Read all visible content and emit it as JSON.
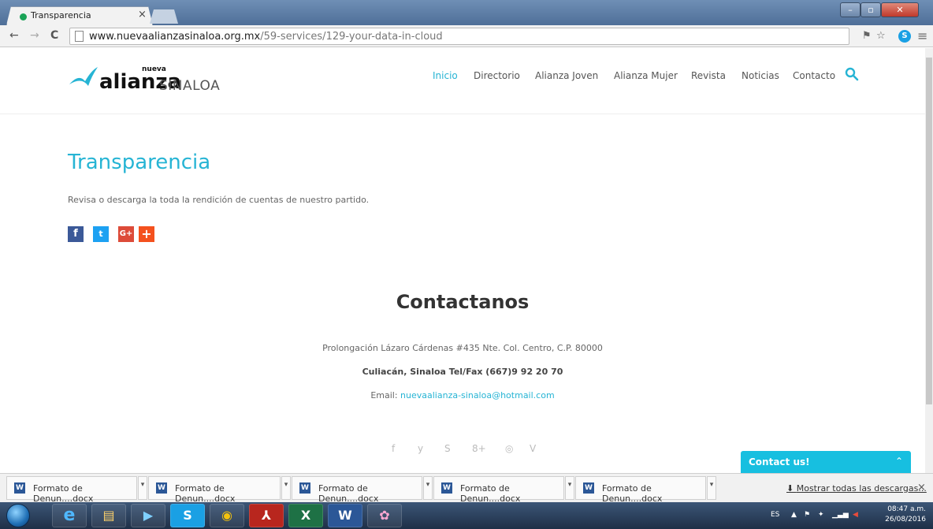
{
  "browser": {
    "tab_title": "Transparencia",
    "tab_close": "×",
    "url_domain": "www.nuevaalianzasinaloa.org.mx",
    "url_path": "/59-services/129-your-data-in-cloud",
    "nav_back": "←",
    "nav_forward": "→",
    "nav_reload": "C",
    "menu_glyph": "≡",
    "star_glyph": "☆",
    "skype_glyph": "S"
  },
  "site": {
    "logo_small": "nueva",
    "logo_main": "alianza",
    "logo_region": "SINALOA",
    "nav": [
      "Inicio",
      "Directorio",
      "Alianza Joven",
      "Alianza Mujer",
      "Revista",
      "Noticias",
      "Contacto"
    ],
    "active_nav": "Inicio",
    "accent_color": "#26b4d4"
  },
  "article": {
    "title": "Transparencia",
    "intro": "Revisa o descarga la toda la rendición de cuentas de nuestro partido.",
    "share": [
      {
        "glyph": "f",
        "color": "#3b5998",
        "icon": "facebook-icon"
      },
      {
        "glyph": "t",
        "color": "#1da1f2",
        "icon": "twitter-icon"
      },
      {
        "glyph": "G+",
        "color": "#dd4b39",
        "icon": "google-plus-icon"
      },
      {
        "glyph": "+",
        "color": "#f4511e",
        "icon": "share-plus-icon"
      }
    ]
  },
  "contact": {
    "heading": "Contactanos",
    "address": "Prolongación Lázaro Cárdenas #435 Nte. Col. Centro, C.P. 80000",
    "city_phone": "Culiacán, Sinaloa Tel/Fax (667)9 92 20 70",
    "email_label": "Email: ",
    "email": "nuevaalianza-sinaloa@hotmail.com",
    "social": [
      "f",
      "y",
      "S",
      "8+",
      "◎",
      "V"
    ]
  },
  "widget": {
    "label": "Contact us!",
    "chevron": "⌃"
  },
  "downloads": {
    "items": [
      "Formato de Denun....docx",
      "Formato de Denun....docx",
      "Formato de Denun....docx",
      "Formato de Denun....docx",
      "Formato de Denun....docx"
    ],
    "show_all": "Mostrar todas las descargas...",
    "close": "×"
  },
  "taskbar": {
    "apps": [
      "e",
      "▤",
      "▶",
      "S",
      "◉",
      "⅄",
      "X",
      "W",
      "✿"
    ],
    "lang": "ES",
    "time": "08:47 a.m.",
    "date": "26/08/2016"
  }
}
